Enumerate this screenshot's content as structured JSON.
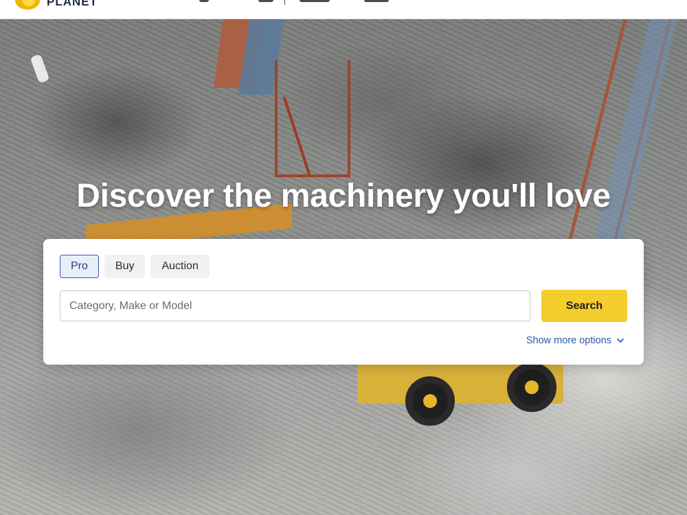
{
  "brand": {
    "logo_text": "PLANET"
  },
  "hero": {
    "headline": "Discover the machinery you'll love"
  },
  "search": {
    "tabs": [
      {
        "label": "Pro",
        "active": true
      },
      {
        "label": "Buy",
        "active": false
      },
      {
        "label": "Auction",
        "active": false
      }
    ],
    "placeholder": "Category, Make or Model",
    "value": "",
    "button_label": "Search",
    "more_options_label": "Show more options",
    "more_options_icon": "chevron-down-icon"
  },
  "colors": {
    "accent_button": "#f4cd2f",
    "link": "#2a5aa8",
    "active_tab_border": "#2e5aa8",
    "logo": "#f2b705"
  }
}
